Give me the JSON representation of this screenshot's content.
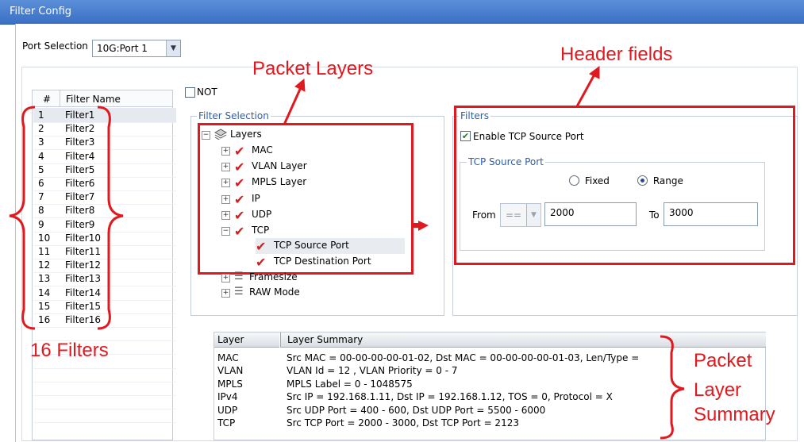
{
  "window": {
    "title": "Filter Config"
  },
  "port_selection": {
    "label": "Port Selection",
    "value": "10G:Port 1"
  },
  "filter_list": {
    "headers": [
      "#",
      "Filter Name"
    ],
    "rows": [
      {
        "num": "1",
        "name": "Filter1"
      },
      {
        "num": "2",
        "name": "Filter2"
      },
      {
        "num": "3",
        "name": "Filter3"
      },
      {
        "num": "4",
        "name": "Filter4"
      },
      {
        "num": "5",
        "name": "Filter5"
      },
      {
        "num": "6",
        "name": "Filter6"
      },
      {
        "num": "7",
        "name": "Filter7"
      },
      {
        "num": "8",
        "name": "Filter8"
      },
      {
        "num": "9",
        "name": "Filter9"
      },
      {
        "num": "10",
        "name": "Filter10"
      },
      {
        "num": "11",
        "name": "Filter11"
      },
      {
        "num": "12",
        "name": "Filter12"
      },
      {
        "num": "13",
        "name": "Filter13"
      },
      {
        "num": "14",
        "name": "Filter14"
      },
      {
        "num": "15",
        "name": "Filter15"
      },
      {
        "num": "16",
        "name": "Filter16"
      }
    ]
  },
  "not_checkbox": {
    "label": "NOT",
    "checked": false
  },
  "filter_selection": {
    "title": "Filter Selection",
    "root": "Layers",
    "layers": [
      "MAC",
      "VLAN Layer",
      "MPLS Layer",
      "IP",
      "UDP",
      "TCP"
    ],
    "tcp_children": [
      "TCP Source Port",
      "TCP Destination Port"
    ],
    "other": [
      "Framesize",
      "RAW Mode"
    ]
  },
  "filters": {
    "title": "Filters",
    "enable_label": "Enable TCP Source Port",
    "enable_checked": true,
    "group_title": "TCP Source Port",
    "fixed_label": "Fixed",
    "range_label": "Range",
    "selected": "Range",
    "from_label": "From",
    "operator": "==",
    "from_value": "2000",
    "to_label": "To",
    "to_value": "3000"
  },
  "summary": {
    "headers": [
      "Layer",
      "Layer Summary"
    ],
    "rows": [
      {
        "layer": "MAC",
        "summary": "Src MAC = 00-00-00-00-01-02, Dst MAC = 00-00-00-00-01-03, Len/Type  ="
      },
      {
        "layer": "VLAN",
        "summary": "VLAN Id = 12  ,  VLAN Priority = 0 - 7"
      },
      {
        "layer": "MPLS",
        "summary": "MPLS Label = 0 - 1048575"
      },
      {
        "layer": "IPv4",
        "summary": "Src IP = 192.168.1.11, Dst IP = 192.168.1.12, TOS = 0, Protocol = X"
      },
      {
        "layer": "UDP",
        "summary": "Src UDP Port = 400 - 600, Dst UDP Port = 5500 - 6000"
      },
      {
        "layer": "TCP",
        "summary": "Src TCP Port = 2000 - 3000, Dst TCP Port = 2123"
      }
    ]
  },
  "annotations": {
    "packet_layers": "Packet Layers",
    "header_fields": "Header fields",
    "filters_count": "16 Filters",
    "summary_line1": "Packet",
    "summary_line2": "Layer",
    "summary_line3": "Summary"
  },
  "colors": {
    "annotation": "#e0191f",
    "titlebar": "#4a7fd0",
    "check": "#d21e1e"
  }
}
